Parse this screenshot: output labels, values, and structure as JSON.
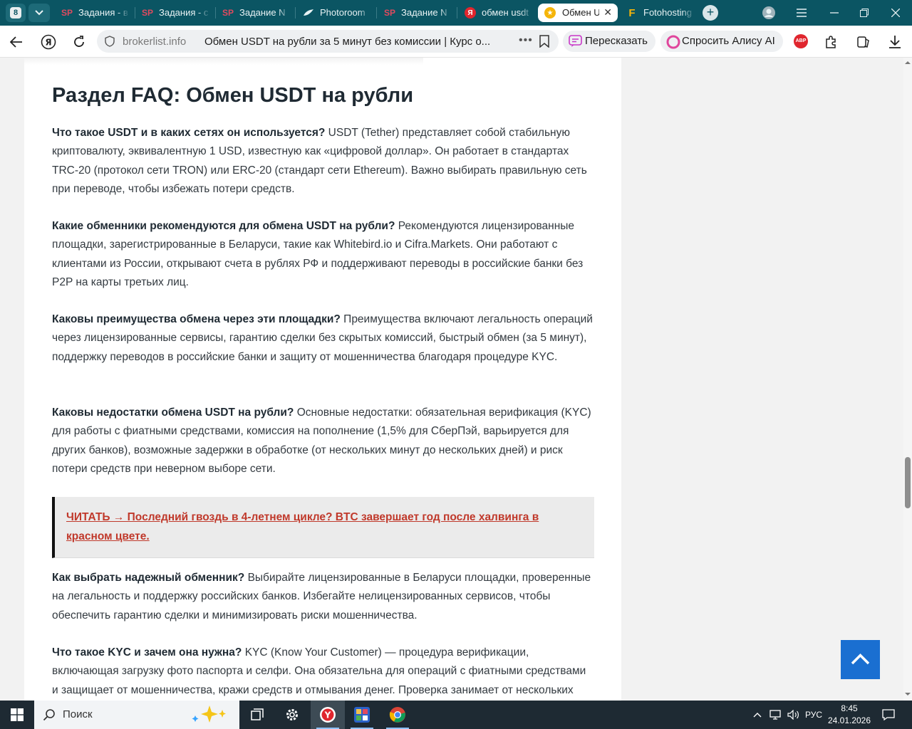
{
  "browser": {
    "tab_count": "8",
    "tabs": [
      {
        "label": "Задания - в",
        "icon": "SP"
      },
      {
        "label": "Задания - с",
        "icon": "SP"
      },
      {
        "label": "Задание N",
        "icon": "SP"
      },
      {
        "label": "Photoroom",
        "icon": ""
      },
      {
        "label": "Задание N",
        "icon": "SP"
      },
      {
        "label": "обмен usdt",
        "icon": "Я"
      },
      {
        "label": "Обмен U",
        "icon": "★"
      },
      {
        "label": "Fotohosting",
        "icon": "F"
      }
    ],
    "address": {
      "domain": "brokerlist.info",
      "title": "Обмен USDT на рубли за 5 минут без комиссии | Курс о..."
    },
    "retell_label": "Пересказать",
    "alice_label": "Спросить Алису AI",
    "abp_label": "ABP"
  },
  "article": {
    "heading": "Раздел FAQ: Обмен USDT на рубли",
    "faq": [
      {
        "question": "Что такое USDT и в каких сетях он используется?",
        "answer": "USDT (Tether) представляет собой стабильную криптовалюту, эквивалентную 1 USD, известную как «цифровой доллар». Он работает в стандартах TRC-20 (протокол сети TRON) или ERC-20 (стандарт сети Ethereum). Важно выбирать правильную сеть при переводе, чтобы избежать потери средств."
      },
      {
        "question": "Какие обменники рекомендуются для обмена USDT на рубли?",
        "answer": "Рекомендуются лицензированные площадки, зарегистрированные в Беларуси, такие как Whitebird.io и Cifra.Markets. Они работают с клиентами из России, открывают счета в рублях РФ и поддерживают переводы в российские банки без P2P на карты третьих лиц."
      },
      {
        "question": "Каковы преимущества обмена через эти площадки?",
        "answer": "Преимущества включают легальность операций через лицензированные сервисы, гарантию сделки без скрытых комиссий, быстрый обмен (за 5 минут), поддержку переводов в российские банки и защиту от мошенничества благодаря процедуре KYC."
      },
      {
        "question": "Каковы недостатки обмена USDT на рубли?",
        "answer": "Основные недостатки: обязательная верификация (KYC) для работы с фиатными средствами, комиссия на пополнение (1,5% для СберПэй, варьируется для других банков), возможные задержки в обработке (от нескольких минут до нескольких дней) и риск потери средств при неверном выборе сети."
      },
      {
        "question": "Как выбрать надежный обменник?",
        "answer": "Выбирайте лицензированные в Беларуси площадки, проверенные на легальность и поддержку российских банков. Избегайте нелицензированных сервисов, чтобы обеспечить гарантию сделки и минимизировать риски мошенничества."
      },
      {
        "question": "Что такое KYC и зачем она нужна?",
        "answer": "KYC (Know Your Customer) — процедура верификации, включающая загрузку фото паспорта и селфи. Она обязательна для операций с фиатными средствами и защищает от мошенничества, кражи средств и отмывания денег. Проверка занимает от нескольких"
      }
    ],
    "read_more": "ЧИТАТЬ →  Последний гвоздь в 4-летнем цикле? BTC завершает год после халвинга в красном цвете."
  },
  "taskbar": {
    "search_label": "Поиск",
    "language": "РУС",
    "time": "8:45",
    "date": "24.01.2026"
  },
  "colors": {
    "tabbar": "#0b5563",
    "link": "#c0392b",
    "scroll_top_button": "#1a6fd1",
    "taskbar": "#1e2a33"
  }
}
